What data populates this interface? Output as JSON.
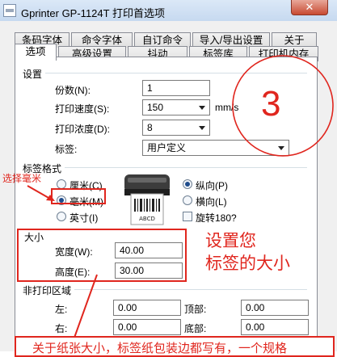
{
  "window": {
    "title": "Gprinter  GP-1124T 打印首选项",
    "close_glyph": "✕"
  },
  "tabs_row1": [
    "条码字体",
    "命令字体",
    "自订命令",
    "导入/导出设置",
    "关于"
  ],
  "tabs_row2": [
    "选项",
    "高级设置",
    "抖动",
    "标签库",
    "打印机内存"
  ],
  "selected_tab": "选项",
  "settings": {
    "group_label": "设置",
    "copies": {
      "label": "份数(N):",
      "value": "1"
    },
    "speed": {
      "label": "打印速度(S):",
      "value": "150",
      "unit": "mm/s"
    },
    "density": {
      "label": "打印浓度(D):",
      "value": "8"
    },
    "label_stock": {
      "label": "标签:",
      "value": "用户定义"
    }
  },
  "label_format": {
    "group_label": "标签格式",
    "units": [
      {
        "label": "厘米(C)",
        "checked": false
      },
      {
        "label": "毫米(M)",
        "checked": true
      },
      {
        "label": "英寸(I)",
        "checked": false
      }
    ],
    "orientation": [
      {
        "label": "纵向(P)",
        "checked": true
      },
      {
        "label": "横向(L)",
        "checked": false
      }
    ],
    "rotate": {
      "label": "旋转180?",
      "checked": false
    },
    "preview_text": "ABCD"
  },
  "size": {
    "group_label": "大小",
    "width": {
      "label": "宽度(W):",
      "value": "40.00"
    },
    "height": {
      "label": "高度(E):",
      "value": "30.00"
    }
  },
  "nonprint": {
    "group_label": "非打印区域",
    "left": {
      "label": "左:",
      "value": "0.00"
    },
    "top": {
      "label": "顶部:",
      "value": "0.00"
    },
    "right": {
      "label": "右:",
      "value": "0.00"
    },
    "bottom": {
      "label": "底部:",
      "value": "0.00"
    }
  },
  "annotations": {
    "circle_number": "3",
    "select_mm": "选择毫米",
    "set_size_line1": "设置您",
    "set_size_line2": "标签的大小",
    "bottom_note": "关于纸张大小，标签纸包装边都写有，一个规格"
  },
  "colors": {
    "annotation_red": "#e0261e",
    "title_bar": "#c6d9f0",
    "dialog_bg": "#f0f0f0"
  }
}
